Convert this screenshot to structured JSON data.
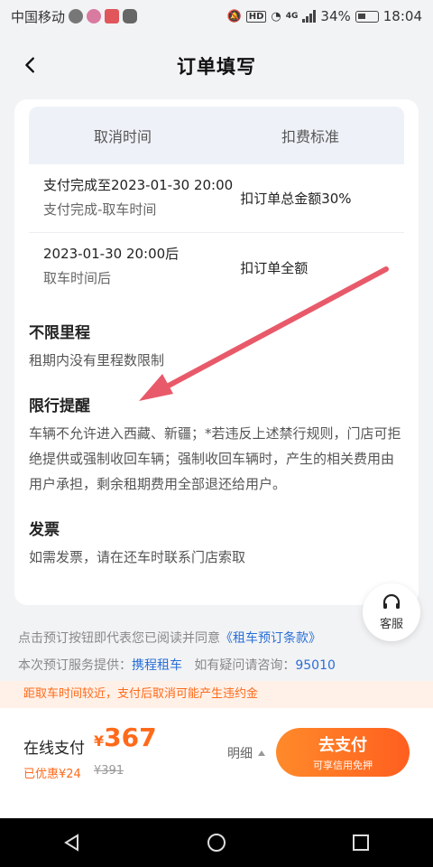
{
  "status_bar": {
    "carrier": "中国移动",
    "network": "4G",
    "battery": "34%",
    "time": "18:04"
  },
  "header": {
    "title": "订单填写"
  },
  "table": {
    "col1": "取消时间",
    "col2": "扣费标准",
    "rows": [
      {
        "main": "支付完成至2023-01-30 20:00",
        "sub": "支付完成-取车时间",
        "fee": "扣订单总金额30%"
      },
      {
        "main": "2023-01-30 20:00后",
        "sub": "取车时间后",
        "fee": "扣订单全额"
      }
    ]
  },
  "sections": {
    "mileage": {
      "title": "不限里程",
      "text": "租期内没有里程数限制"
    },
    "restriction": {
      "title": "限行提醒",
      "text": "车辆不允许进入西藏、新疆；*若违反上述禁行规则，门店可拒绝提供或强制收回车辆；强制收回车辆时，产生的相关费用由用户承担，剩余租期费用全部退还给用户。"
    },
    "invoice": {
      "title": "发票",
      "text": "如需发票，请在还车时联系门店索取"
    }
  },
  "customer_service": {
    "label": "客服"
  },
  "notes": {
    "agree_prefix": "点击预订按钮即代表您已阅读并同意",
    "agree_link": "《租车预订条款》",
    "provider_prefix": "本次预订服务提供：",
    "provider": "携程租车",
    "consult_prefix": "如有疑问请咨询：",
    "consult_number": "95010",
    "warning": "距取车时间较近，支付后取消可能产生违约金"
  },
  "bottom": {
    "pay_label": "在线支付",
    "currency": "¥",
    "price": "367",
    "discount": "已优惠¥24",
    "original": "¥391",
    "detail": "明细",
    "pay_button": "去支付",
    "pay_sub": "可享信用免押"
  },
  "colors": {
    "accent": "#ff6a1a",
    "link": "#2a6fd6",
    "annotation_arrow": "#e85a6a"
  }
}
